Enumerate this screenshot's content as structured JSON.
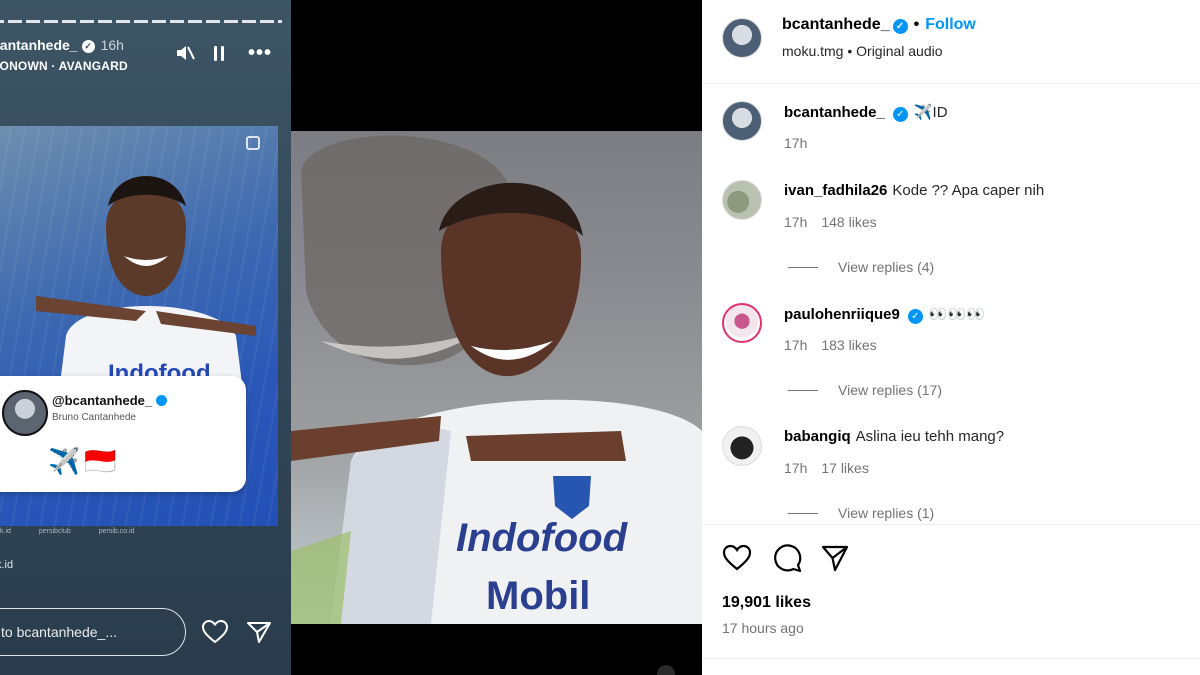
{
  "story": {
    "username": "cantanhede_",
    "verified_mark": "✓",
    "time": "16h",
    "audio": "LONOWN · AVANGARD",
    "sticker": {
      "handle": "@bcantanhede_",
      "name": "Bruno Cantanhede",
      "emoji": "✈️🇮🇩"
    },
    "footer_items": [
      "k.id",
      "persibclub",
      "persib.co.id"
    ],
    "link": "k.id",
    "reply_placeholder": "to bcantanhede_..."
  },
  "post": {
    "username": "bcantanhede_",
    "follow_label": "Follow",
    "dot": "•",
    "audio_line": "moku.tmg • Original audio",
    "caption": {
      "username": "bcantanhede_",
      "text": "✈️ID",
      "time": "17h"
    },
    "comments": [
      {
        "username": "ivan_fadhila26",
        "text": "Kode ?? Apa caper nih",
        "time": "17h",
        "likes": "148 likes",
        "replies": "View replies (4)"
      },
      {
        "username": "paulohenriique9",
        "text": "👀👀👀",
        "time": "17h",
        "likes": "183 likes",
        "replies": "View replies (17)"
      },
      {
        "username": "babangiq",
        "text": "Aslina ieu tehh mang?",
        "time": "17h",
        "likes": "17 likes",
        "replies": "View replies (1)"
      }
    ],
    "likes_total": "19,901 likes",
    "posted_ago": "17 hours ago"
  },
  "colors": {
    "verified": "#0095f6",
    "follow": "#0095f6",
    "muted_text": "#737373",
    "story_bg": "#34495c"
  },
  "icons": [
    "mute-icon",
    "pause-icon",
    "more-icon",
    "heart-icon",
    "comment-icon",
    "share-icon",
    "send-icon"
  ]
}
